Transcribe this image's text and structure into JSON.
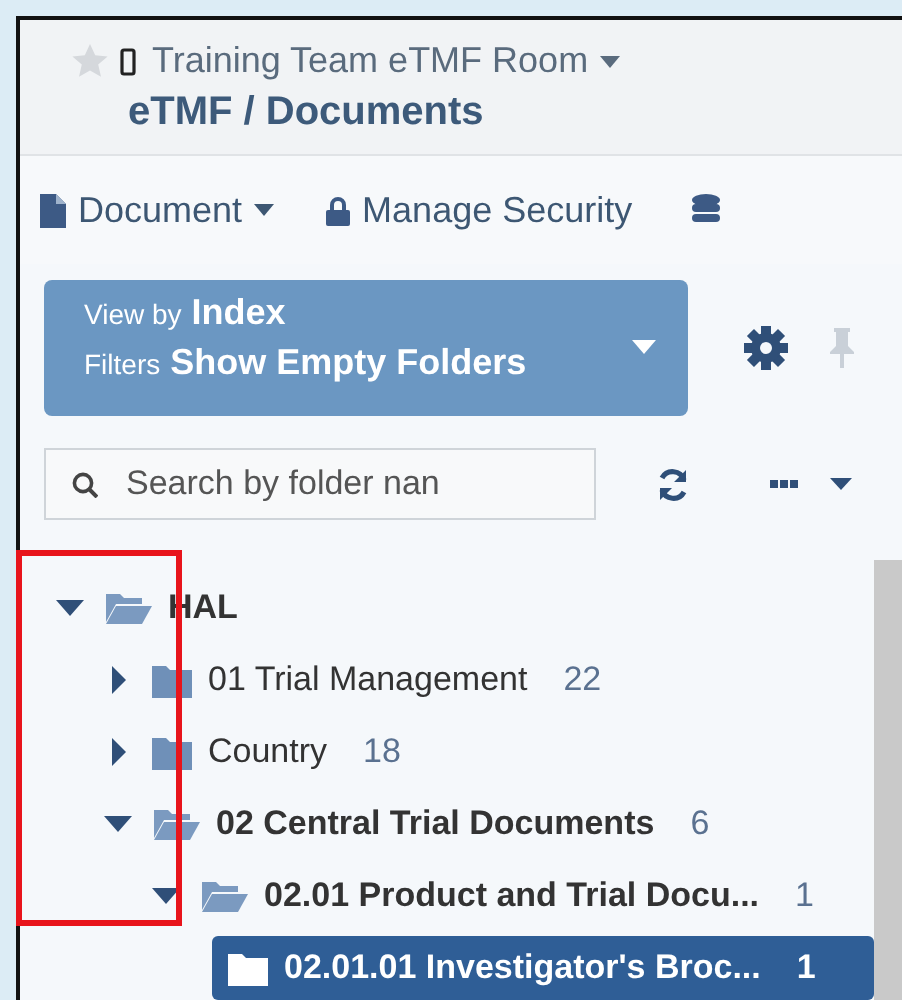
{
  "header": {
    "starred": false,
    "room_title": "Training Team eTMF Room",
    "breadcrumb": "eTMF / Documents"
  },
  "toolbar": [
    {
      "kind": "document",
      "label": "Document"
    },
    {
      "kind": "security",
      "label": "Manage Security"
    },
    {
      "kind": "database"
    }
  ],
  "view_panel": {
    "view_by_label": "View by",
    "view_by": "Index",
    "filters_label": "Filters",
    "filters": "Show Empty Folders"
  },
  "search": {
    "placeholder": "Search by folder nan"
  },
  "tree": [
    {
      "label": "HAL",
      "expanded": true,
      "selected": false,
      "children": [
        {
          "label": "01 Trial Management",
          "count": "22",
          "expanded": false,
          "selected": false
        },
        {
          "label": "Country",
          "count": "18",
          "expanded": false,
          "selected": false
        },
        {
          "label": "02 Central Trial Documents",
          "count": "6",
          "expanded": true,
          "selected": false,
          "children": [
            {
              "label": "02.01 Product and Trial Docu...",
              "count": "1",
              "expanded": true,
              "selected": false,
              "children": [
                {
                  "label": "02.01.01 Investigator's Broc...",
                  "count": "1",
                  "expanded": false,
                  "selected": true
                }
              ]
            }
          ]
        }
      ]
    }
  ]
}
